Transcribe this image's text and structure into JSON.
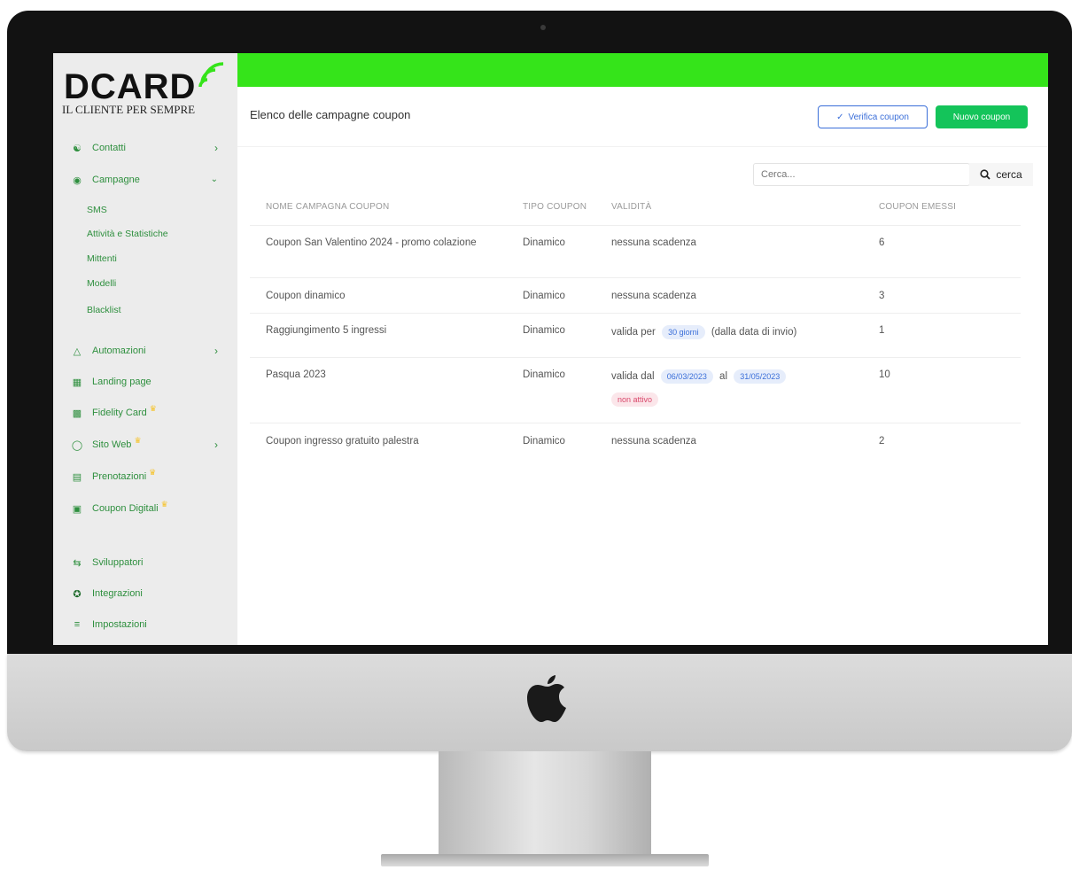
{
  "brand": {
    "logo_text": "DCARD",
    "tagline": "IL CLIENTE PER SEMPRE"
  },
  "sidebar": {
    "items": [
      {
        "label": "Contatti"
      },
      {
        "label": "Campagne"
      },
      {
        "label": "Automazioni"
      },
      {
        "label": "Landing page"
      },
      {
        "label": "Fidelity Card"
      },
      {
        "label": "Sito Web"
      },
      {
        "label": "Prenotazioni"
      },
      {
        "label": "Coupon Digitali"
      },
      {
        "label": "Sviluppatori"
      },
      {
        "label": "Integrazioni"
      },
      {
        "label": "Impostazioni"
      }
    ],
    "campagne_sub": [
      {
        "label": "SMS"
      },
      {
        "label": "Attività e Statistiche"
      },
      {
        "label": "Mittenti"
      },
      {
        "label": "Modelli"
      },
      {
        "label": "Blacklist"
      }
    ]
  },
  "header": {
    "title": "Elenco delle campagne coupon",
    "verify_label": "Verifica coupon",
    "new_label": "Nuovo coupon"
  },
  "search": {
    "placeholder": "Cerca...",
    "button_label": "cerca"
  },
  "table": {
    "headers": [
      "NOME CAMPAGNA COUPON",
      "TIPO COUPON",
      "VALIDITÀ",
      "COUPON EMESSI"
    ],
    "rows": [
      {
        "name": "Coupon San Valentino 2024 - promo colazione",
        "type": "Dinamico",
        "validity": "nessuna scadenza",
        "issued": "6"
      },
      {
        "name": "Coupon dinamico",
        "type": "Dinamico",
        "validity": "nessuna scadenza",
        "issued": "3"
      },
      {
        "name": "Raggiungimento 5 ingressi",
        "type": "Dinamico",
        "validity_prefix": "valida per",
        "validity_tag": "30 giorni",
        "validity_suffix": "(dalla data di invio)",
        "issued": "1"
      },
      {
        "name": "Pasqua 2023",
        "type": "Dinamico",
        "validity_prefix": "valida dal",
        "date_from": "06/03/2023",
        "validity_mid": "al",
        "date_to": "31/05/2023",
        "status": "non attivo",
        "issued": "10"
      },
      {
        "name": "Coupon ingresso gratuito palestra",
        "type": "Dinamico",
        "validity": "nessuna scadenza",
        "issued": "2"
      }
    ]
  },
  "colors": {
    "accent_green": "#35e41a",
    "button_green": "#14c45a",
    "link_blue": "#3b6fd9",
    "nav_green": "#2e8f3e"
  }
}
